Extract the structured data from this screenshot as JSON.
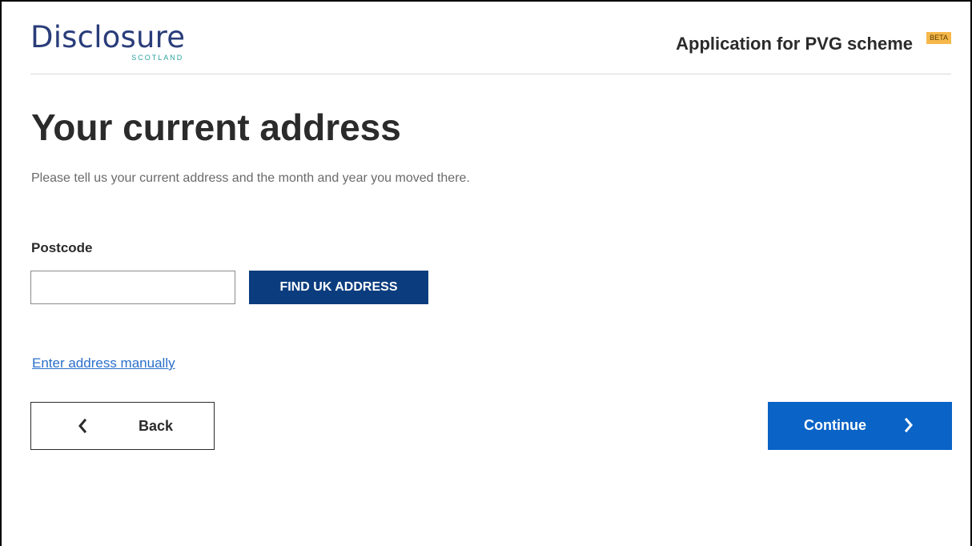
{
  "header": {
    "logo_text": "Disclosure",
    "logo_subtext": "SCOTLAND",
    "service_name": "Application for PVG scheme",
    "beta_label": "BETA"
  },
  "main": {
    "title": "Your current address",
    "lead": "Please tell us your current address and the month and year you moved there.",
    "postcode": {
      "label": "Postcode",
      "value": "",
      "placeholder": ""
    },
    "find_button_label": "FIND UK ADDRESS",
    "manual_link_label": "Enter address manually"
  },
  "navigation": {
    "back_label": "Back",
    "continue_label": "Continue"
  },
  "icons": {
    "back": "chevron-left-icon",
    "continue": "chevron-right-icon"
  },
  "colors": {
    "brand_navy": "#2a3d7a",
    "brand_teal": "#29a39f",
    "find_button": "#0b3d7e",
    "continue_button": "#0a63c6",
    "link": "#2a6fc9",
    "beta_badge": "#f6b84a"
  }
}
